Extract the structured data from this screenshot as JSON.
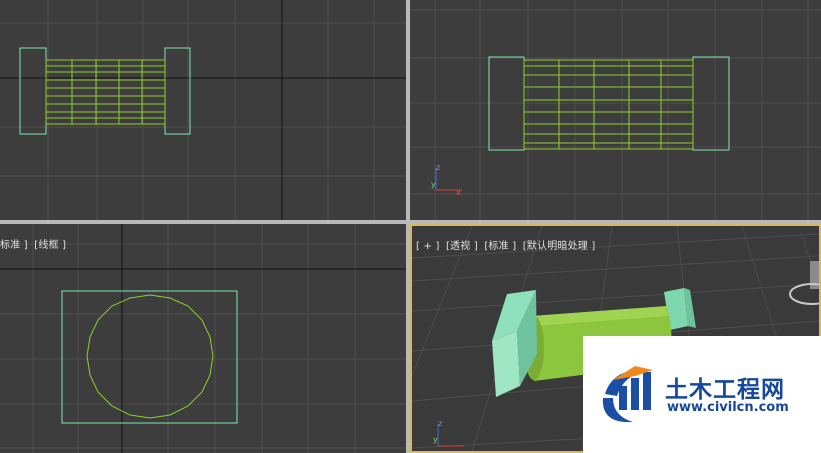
{
  "viewports": {
    "left": {
      "label_parts": [
        "标准 ]",
        "[线框 ]"
      ]
    },
    "perspective": {
      "label_parts": [
        "[ + ]",
        "[透视 ]",
        "[标准 ]",
        "[默认明暗处理 ]"
      ]
    }
  },
  "axis_gizmo": {
    "z": "z",
    "y": "y",
    "x": "x"
  },
  "watermark": {
    "name_cn": "土木工程网",
    "url": "www.civilcn.com"
  },
  "colors": {
    "grid": "#4f4f4f",
    "grid_axis": "#101010",
    "bounding_box": "#7ee8b0",
    "cylinder_wire": "#8ecf2e",
    "end_block": "#8ddfb8",
    "cylinder_solid": "#8cc63f",
    "active_border": "#d7b85a"
  }
}
